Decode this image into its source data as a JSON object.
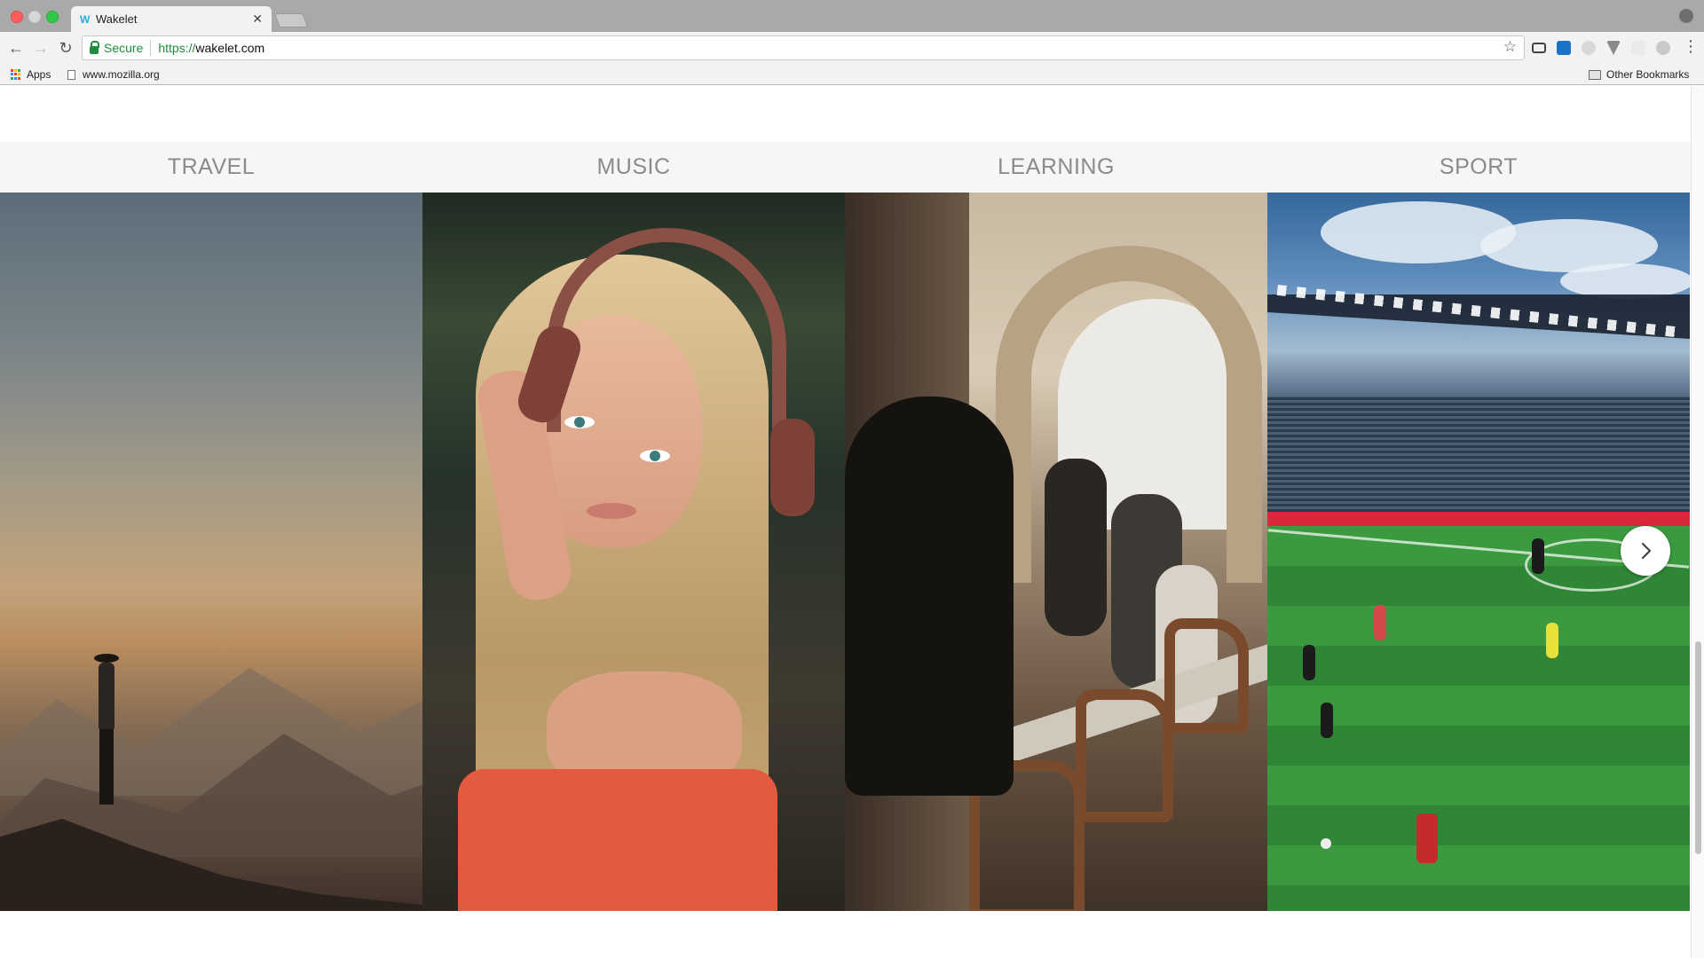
{
  "browser": {
    "tab": {
      "title": "Wakelet",
      "favicon": "W"
    },
    "omnibox": {
      "secure_label": "Secure",
      "url_scheme": "https://",
      "url_host": "wakelet.com"
    },
    "bookmarks": {
      "apps_label": "Apps",
      "item_1": "www.mozilla.org",
      "other_label": "Other Bookmarks"
    },
    "colors": {
      "secure_green": "#1e8e3e",
      "tab_strip": "#a9a9a9",
      "toolbar": "#f2f2f2"
    }
  },
  "categories": [
    {
      "label": "TRAVEL"
    },
    {
      "label": "MUSIC"
    },
    {
      "label": "LEARNING"
    },
    {
      "label": "SPORT"
    }
  ],
  "carousel": {
    "next_icon": "chevron-right-icon"
  }
}
